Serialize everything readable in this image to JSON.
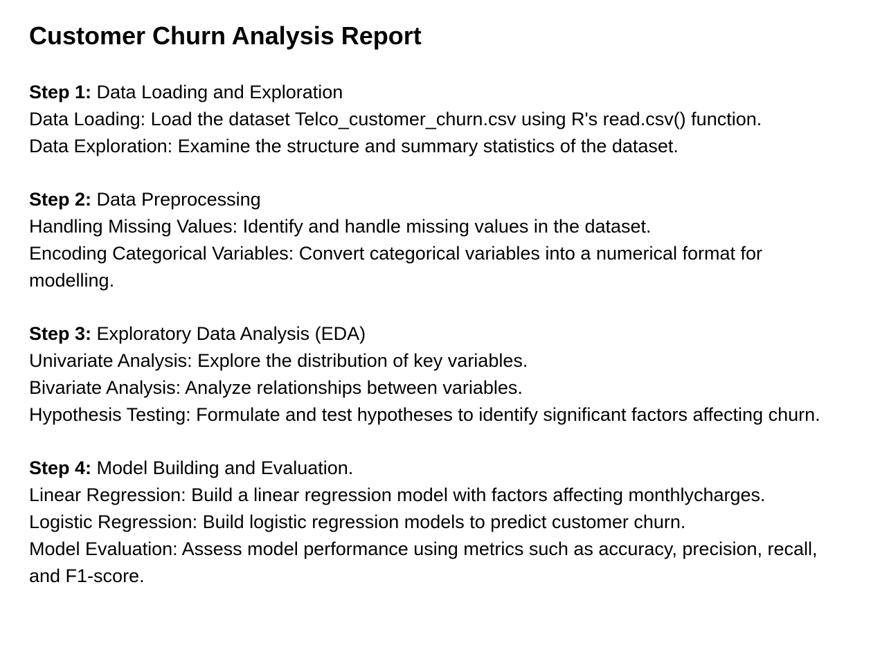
{
  "title": "Customer Churn Analysis Report",
  "steps": [
    {
      "label": "Step 1:",
      "heading": " Data Loading and Exploration",
      "items": [
        "Data Loading: Load the dataset Telco_customer_churn.csv using R's read.csv() function.",
        "Data Exploration: Examine the structure and summary statistics of the dataset."
      ]
    },
    {
      "label": "Step 2:",
      "heading": " Data Preprocessing",
      "items": [
        "Handling Missing Values: Identify and handle missing values in the dataset.",
        "Encoding Categorical Variables: Convert categorical variables into a numerical format for modelling."
      ]
    },
    {
      "label": "Step 3:",
      "heading": " Exploratory Data Analysis (EDA)",
      "items": [
        "Univariate Analysis: Explore the distribution of key variables.",
        "Bivariate Analysis: Analyze relationships between variables.",
        "Hypothesis Testing: Formulate and test hypotheses to identify significant factors affecting churn."
      ]
    },
    {
      "label": "Step 4:",
      "heading": " Model Building and Evaluation.",
      "items": [
        "Linear Regression: Build a linear regression model with factors affecting monthlycharges.",
        "Logistic Regression: Build logistic regression models to predict customer churn.",
        "Model Evaluation: Assess model performance using metrics such as accuracy, precision, recall, and F1-score."
      ]
    }
  ]
}
